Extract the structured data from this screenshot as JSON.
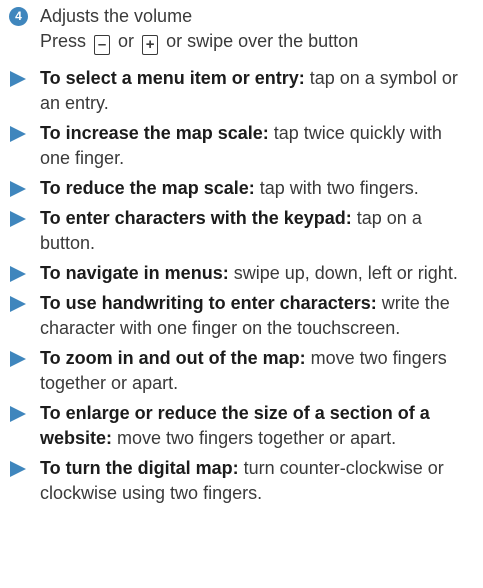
{
  "numbered_item": {
    "number": "4",
    "title": "Adjusts the volume",
    "line2_prefix": "Press",
    "key_minus": "–",
    "line2_or": "or",
    "key_plus": "+",
    "line2_suffix": "or swipe over the button"
  },
  "bullets": [
    {
      "lead": "To select a menu item or entry:",
      "text": " tap on a symbol or an entry."
    },
    {
      "lead": "To increase the map scale:",
      "text": " tap twice quickly with one finger."
    },
    {
      "lead": "To reduce the map scale:",
      "text": " tap with two fingers."
    },
    {
      "lead": "To enter characters with the keypad:",
      "text": " tap on a button."
    },
    {
      "lead": "To navigate in menus:",
      "text": " swipe up, down, left or right."
    },
    {
      "lead": "To use handwriting to enter characters:",
      "text": " write the character with one finger on the touchscreen."
    },
    {
      "lead": "To zoom in and out of the map:",
      "text": " move two fingers together or apart."
    },
    {
      "lead": "To enlarge or reduce the size of a section of a website:",
      "text": " move two fingers together or apart."
    },
    {
      "lead": "To turn the digital map:",
      "text": " turn counter-clockwise or clockwise using two fingers."
    }
  ],
  "colors": {
    "accent": "#3f86bd",
    "text": "#3a3a3a"
  },
  "icons": {
    "number_badge": "circled-number-4-icon",
    "bullet": "right-triangle-arrow-icon"
  }
}
